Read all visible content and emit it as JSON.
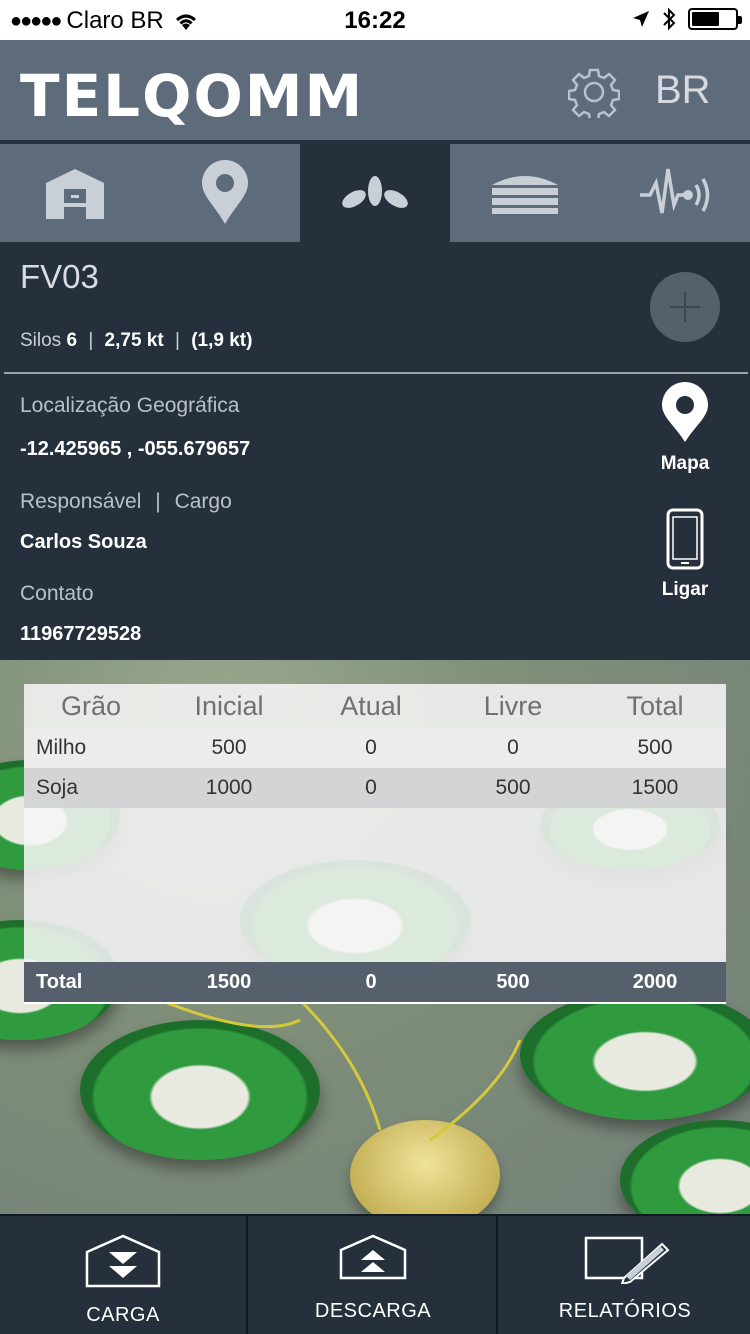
{
  "status_bar": {
    "carrier": "Claro BR",
    "time": "16:22",
    "battery_level": 0.65
  },
  "header": {
    "logo": "TELQOMM",
    "language": "BR"
  },
  "tabs": [
    {
      "icon": "warehouse-icon",
      "active": false
    },
    {
      "icon": "location-pin-icon",
      "active": false
    },
    {
      "icon": "grain-leaves-icon",
      "active": true
    },
    {
      "icon": "silo-layers-icon",
      "active": false
    },
    {
      "icon": "signal-wave-icon",
      "active": false
    }
  ],
  "site": {
    "name": "FV03",
    "silos_label": "Silos",
    "silos_count": "6",
    "capacity": "2,75 kt",
    "used": "(1,9 kt)",
    "location_label": "Localização Geográfica",
    "coordinates": "-12.425965 , -055.679657",
    "responsible_label": "Responsável",
    "role_label": "Cargo",
    "responsible_name": "Carlos Souza",
    "contact_label": "Contato",
    "contact_value": "11967729528"
  },
  "actions": {
    "map_label": "Mapa",
    "call_label": "Ligar"
  },
  "grain_table": {
    "headers": [
      "Grão",
      "Inicial",
      "Atual",
      "Livre",
      "Total"
    ],
    "rows": [
      [
        "Milho",
        "500",
        "0",
        "0",
        "500"
      ],
      [
        "Soja",
        "1000",
        "0",
        "500",
        "1500"
      ]
    ],
    "footer": [
      "Total",
      "1500",
      "0",
      "500",
      "2000"
    ]
  },
  "bottom_bar": {
    "load_label": "CARGA",
    "unload_label": "DESCARGA",
    "reports_label": "RELATÓRIOS"
  },
  "colors": {
    "header_bg": "#5d6b7b",
    "panel_bg": "#26303d",
    "table_footer_bg": "#56606d"
  }
}
